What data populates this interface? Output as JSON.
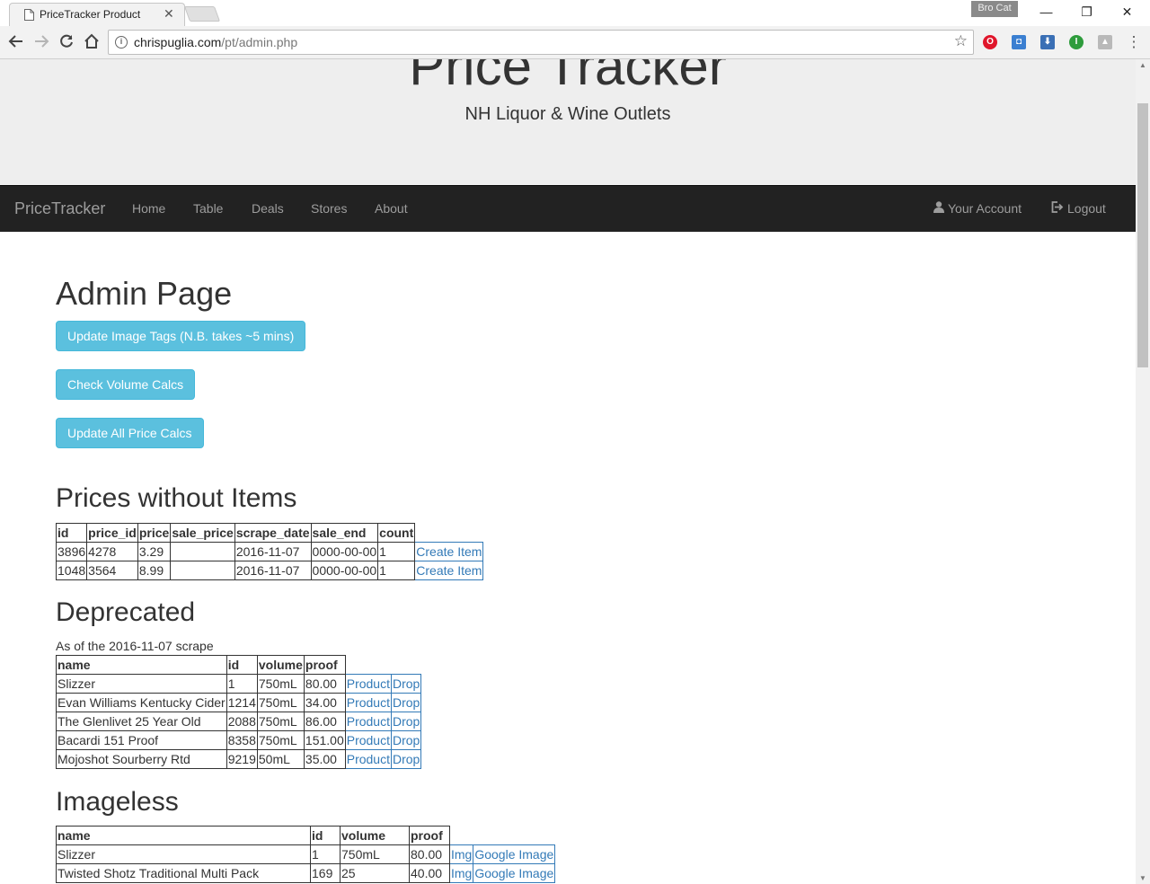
{
  "browser": {
    "tab_title": "PriceTracker Product",
    "profile_name": "Bro Cat",
    "url_host": "chrispuglia.com",
    "url_path": "/pt/admin.php"
  },
  "site": {
    "title": "Price Tracker",
    "subtitle": "NH Liquor & Wine Outlets"
  },
  "navbar": {
    "brand": "PriceTracker",
    "links": [
      "Home",
      "Table",
      "Deals",
      "Stores",
      "About"
    ],
    "account": "Your Account",
    "logout": "Logout"
  },
  "page": {
    "heading": "Admin Page",
    "buttons": {
      "update_tags": "Update Image Tags (N.B. takes ~5 mins)",
      "check_volume": "Check Volume Calcs",
      "update_prices": "Update All Price Calcs"
    }
  },
  "prices_without_items": {
    "heading": "Prices without Items",
    "columns": [
      "id",
      "price_id",
      "price",
      "sale_price",
      "scrape_date",
      "sale_end",
      "count"
    ],
    "rows": [
      {
        "id": "3896",
        "price_id": "4278",
        "price": "3.29",
        "sale_price": "",
        "scrape_date": "2016-11-07",
        "sale_end": "0000-00-00",
        "count": "1",
        "action": "Create Item"
      },
      {
        "id": "1048",
        "price_id": "3564",
        "price": "8.99",
        "sale_price": "",
        "scrape_date": "2016-11-07",
        "sale_end": "0000-00-00",
        "count": "1",
        "action": "Create Item"
      }
    ]
  },
  "deprecated": {
    "heading": "Deprecated",
    "note": "As of the 2016-11-07 scrape",
    "columns": [
      "name",
      "id",
      "volume",
      "proof"
    ],
    "rows": [
      {
        "name": "Slizzer",
        "id": "1",
        "volume": "750mL",
        "proof": "80.00",
        "link1": "Product",
        "link2": "Drop"
      },
      {
        "name": "Evan Williams Kentucky Cider",
        "id": "1214",
        "volume": "750mL",
        "proof": "34.00",
        "link1": "Product",
        "link2": "Drop"
      },
      {
        "name": "The Glenlivet 25 Year Old",
        "id": "2088",
        "volume": "750mL",
        "proof": "86.00",
        "link1": "Product",
        "link2": "Drop"
      },
      {
        "name": "Bacardi 151 Proof",
        "id": "8358",
        "volume": "750mL",
        "proof": "151.00",
        "link1": "Product",
        "link2": "Drop"
      },
      {
        "name": "Mojoshot Sourberry Rtd",
        "id": "9219",
        "volume": "50mL",
        "proof": "35.00",
        "link1": "Product",
        "link2": "Drop"
      }
    ]
  },
  "imageless": {
    "heading": "Imageless",
    "columns": [
      "name",
      "id",
      "volume",
      "proof"
    ],
    "rows": [
      {
        "name": "Slizzer",
        "id": "1",
        "volume": "750mL",
        "proof": "80.00",
        "link1": "Img",
        "link2": "Google Image"
      },
      {
        "name": "Twisted Shotz Traditional Multi Pack",
        "id": "169",
        "volume": "25",
        "proof": "40.00",
        "link1": "Img",
        "link2": "Google Image"
      }
    ]
  }
}
